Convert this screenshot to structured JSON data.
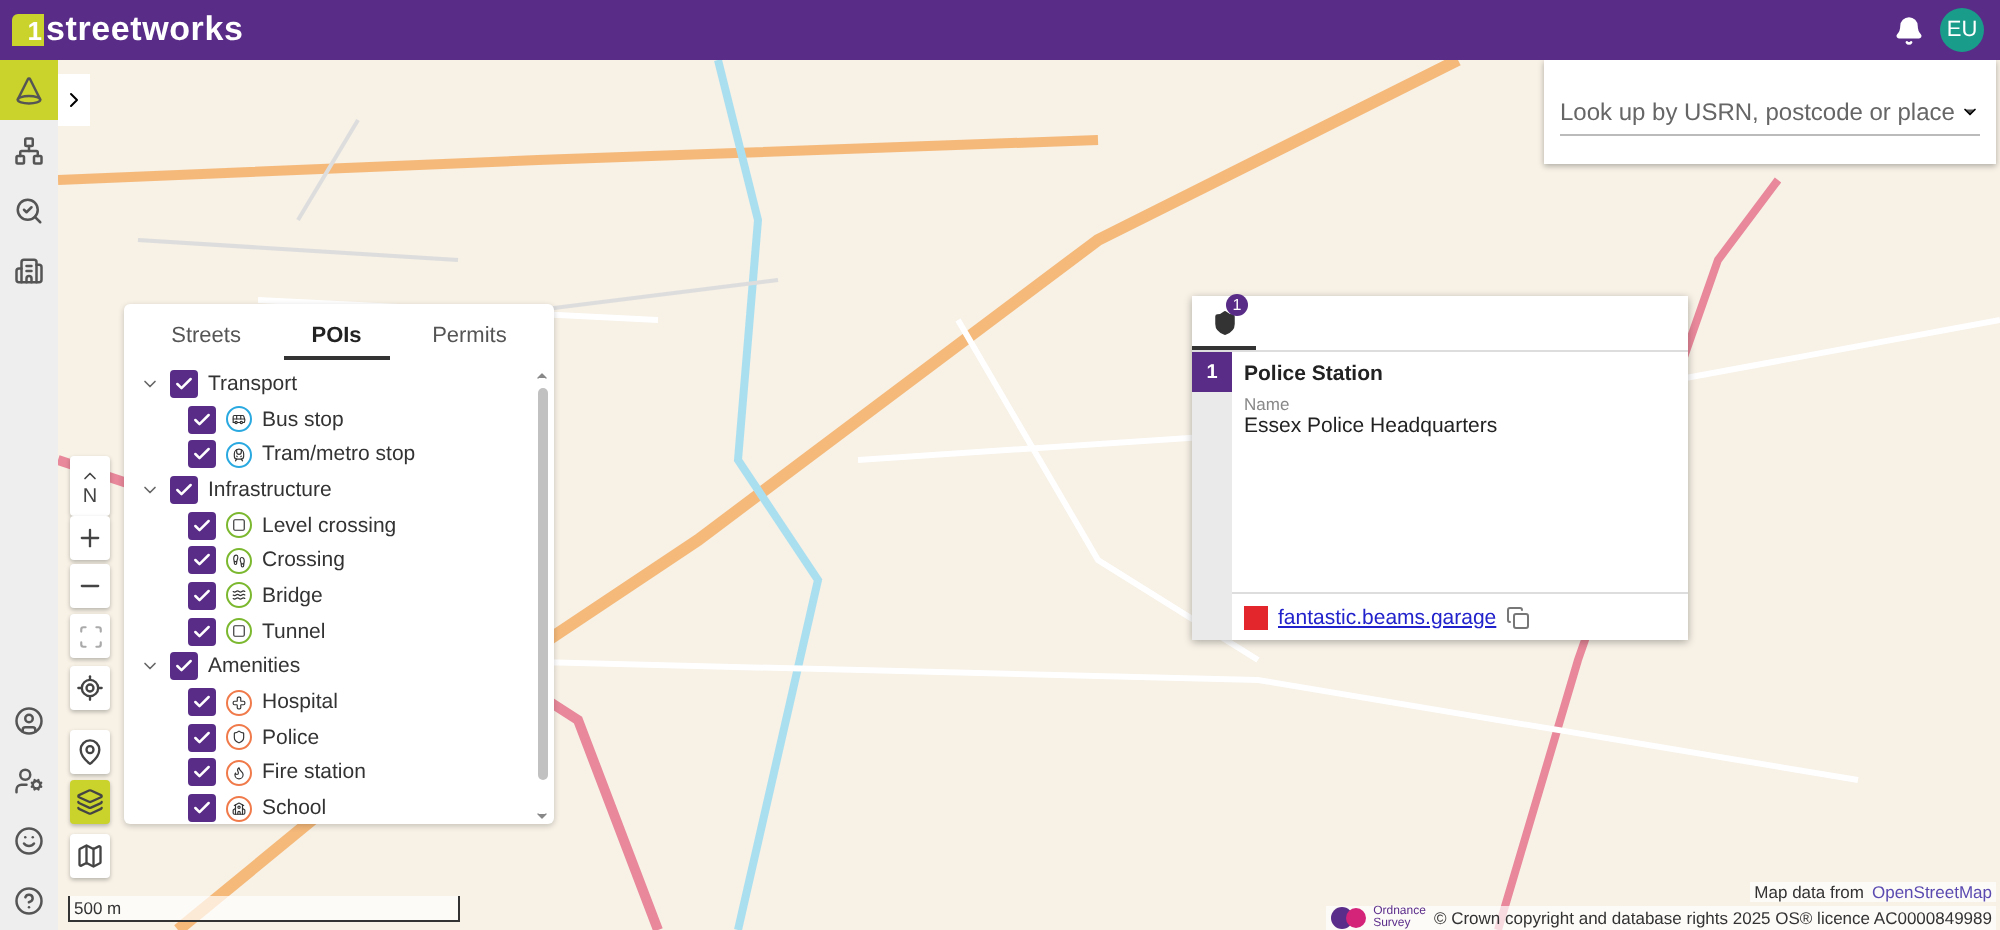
{
  "header": {
    "logo_mark": "1",
    "logo_text": "streetworks",
    "avatar": "EU"
  },
  "sidebar": {
    "top_items": [
      {
        "selected": true
      },
      {
        "selected": false
      },
      {
        "selected": false
      },
      {
        "selected": false
      }
    ],
    "bottom_items": [
      {
        "selected": false
      },
      {
        "selected": false
      },
      {
        "selected": false
      },
      {
        "selected": false
      }
    ]
  },
  "map_controls": {
    "compass": "N",
    "layers_selected": true
  },
  "search": {
    "placeholder": "Look up by USRN, postcode or place"
  },
  "poi_panel": {
    "tabs": [
      {
        "label": "Streets",
        "selected": false
      },
      {
        "label": "POIs",
        "selected": true
      },
      {
        "label": "Permits",
        "selected": false
      }
    ],
    "groups": [
      {
        "label": "Transport",
        "checked": true,
        "expanded": true,
        "children": [
          {
            "label": "Bus stop",
            "checked": true,
            "color": "#29a9e0"
          },
          {
            "label": "Tram/metro stop",
            "checked": true,
            "color": "#29a9e0"
          }
        ]
      },
      {
        "label": "Infrastructure",
        "checked": true,
        "expanded": true,
        "children": [
          {
            "label": "Level crossing",
            "checked": true,
            "color": "#7cb82f"
          },
          {
            "label": "Crossing",
            "checked": true,
            "color": "#7cb82f"
          },
          {
            "label": "Bridge",
            "checked": true,
            "color": "#7cb82f"
          },
          {
            "label": "Tunnel",
            "checked": true,
            "color": "#7cb82f"
          }
        ]
      },
      {
        "label": "Amenities",
        "checked": true,
        "expanded": true,
        "children": [
          {
            "label": "Hospital",
            "checked": true,
            "color": "#f07a4a"
          },
          {
            "label": "Police",
            "checked": true,
            "color": "#f07a4a"
          },
          {
            "label": "Fire station",
            "checked": true,
            "color": "#f07a4a"
          },
          {
            "label": "School",
            "checked": true,
            "color": "#f07a4a"
          }
        ]
      }
    ]
  },
  "popup": {
    "tab_badge": "1",
    "tab_selected": true,
    "index": "1",
    "title": "Police Station",
    "field_label": "Name",
    "field_value": "Essex Police Headquarters",
    "link": "fantastic.beams.garage"
  },
  "scale": "500 m",
  "attribution": {
    "prefix": "Map data from",
    "link": "OpenStreetMap",
    "os_logo": [
      "Ordnance",
      "Survey"
    ],
    "copyright": "© Crown copyright and database rights 2025 OS® licence AC0000849989"
  }
}
